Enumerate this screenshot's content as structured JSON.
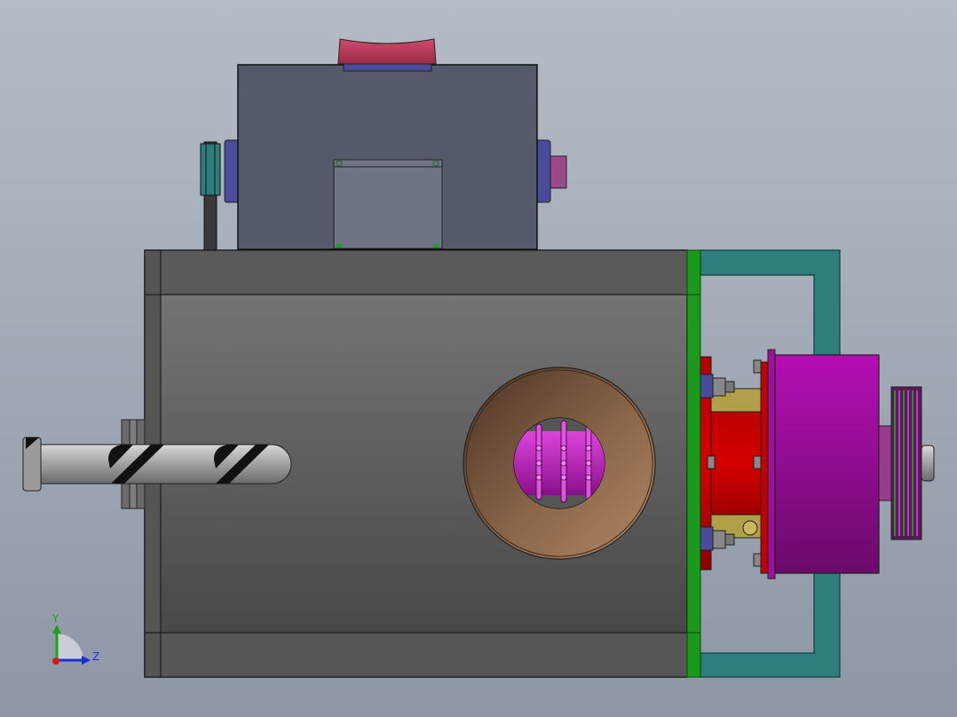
{
  "viewport": {
    "background_top": "#b5bcc6",
    "background_bottom": "#8d97a5"
  },
  "triad": {
    "y_label": "Y",
    "z_label": "Z",
    "y_color": "#1aa31a",
    "z_color": "#1a2fd6",
    "x_color": "#d61a1a"
  },
  "colors": {
    "housing_dark": "#505050",
    "housing_mid": "#787878",
    "motor_body": "#545a6a",
    "motor_panel": "#6e7486",
    "bearing_blue": "#4a4c9a",
    "cap_red": "#c03a5c",
    "bronze_outer": "#5a4332",
    "bronze_inner": "#a07858",
    "rotor_magenta": "#cc22cc",
    "plate_green": "#1a9a1a",
    "frame_teal": "#2e7e7e",
    "flange_red": "#c00000",
    "coupling_olive": "#b0a04a",
    "pulley_magenta": "#9a129a",
    "shaft_gray": "#a8a8a8"
  }
}
